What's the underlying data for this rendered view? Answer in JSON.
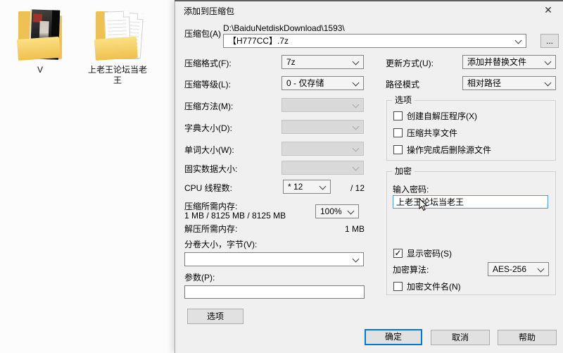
{
  "colors": {
    "accent": "#0078d7",
    "folder_yellow": "#eec152",
    "dialog_bg": "#f0f0f0"
  },
  "desktop": {
    "folders": [
      {
        "label": "V"
      },
      {
        "label": "上老王论坛当老王"
      }
    ]
  },
  "dialog": {
    "title": "添加到压缩包",
    "close_glyph": "✕",
    "archive": {
      "label": "压缩包(A)",
      "path": "D:\\BaiduNetdiskDownload\\1593\\",
      "name": "【H777CC】.7z",
      "browse": "..."
    },
    "rows": {
      "format": {
        "label": "压缩格式(F):",
        "value": "7z"
      },
      "level": {
        "label": "压缩等级(L):",
        "value": "0 - 仅存储"
      },
      "method": {
        "label": "压缩方法(M):",
        "value": ""
      },
      "dict": {
        "label": "字典大小(D):",
        "value": ""
      },
      "word": {
        "label": "单词大小(W):",
        "value": ""
      },
      "solid": {
        "label": "固实数据大小:",
        "value": ""
      },
      "cpu": {
        "label": "CPU 线程数:",
        "value": "* 12",
        "total": "/ 12"
      },
      "mem_c": {
        "label": "压缩所需内存:",
        "detail": "1 MB / 8125 MB / 8125 MB",
        "value": "100%"
      },
      "mem_d": {
        "label": "解压所需内存:",
        "value": "1 MB"
      },
      "volume": {
        "label": "分卷大小，字节(V):",
        "value": ""
      },
      "params": {
        "label": "参数(P):",
        "value": ""
      },
      "options_btn": "选项"
    },
    "right": {
      "update": {
        "label": "更新方式(U):",
        "value": "添加并替换文件"
      },
      "pathmode": {
        "label": "路径模式",
        "value": "相对路径"
      },
      "options": {
        "title": "选项",
        "items": [
          "创建自解压程序(X)",
          "压缩共享文件",
          "操作完成后删除源文件"
        ]
      },
      "encrypt": {
        "title": "加密",
        "pw_label": "输入密码:",
        "pw_value": "上老王论坛当老王",
        "show": "显示密码(S)",
        "check_glyph": "✓",
        "algo_label": "加密算法:",
        "algo_value": "AES-256",
        "names": "加密文件名(N)"
      }
    },
    "footer": {
      "ok": "确定",
      "cancel": "取消",
      "help": "帮助"
    }
  }
}
